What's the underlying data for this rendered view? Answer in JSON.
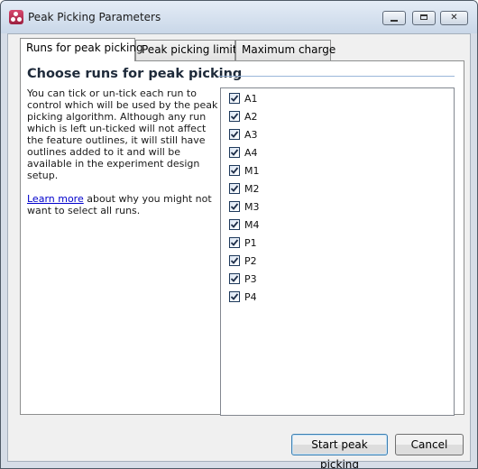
{
  "window": {
    "title": "Peak Picking Parameters"
  },
  "tabs": [
    {
      "label": "Runs for peak picking",
      "active": true
    },
    {
      "label": "Peak picking limits",
      "active": false
    },
    {
      "label": "Maximum charge",
      "active": false
    }
  ],
  "panel": {
    "heading": "Choose runs for peak picking",
    "description": "You can tick or un-tick each run to control which will be used by the peak picking algorithm. Although any run which is left un-ticked will not affect the feature outlines, it will still have outlines added to it and will be available in the experiment design setup.",
    "learn_more_link": "Learn more",
    "learn_more_rest": " about why you might not want to select all runs."
  },
  "runs": [
    {
      "label": "A1",
      "checked": true
    },
    {
      "label": "A2",
      "checked": true
    },
    {
      "label": "A3",
      "checked": true
    },
    {
      "label": "A4",
      "checked": true
    },
    {
      "label": "M1",
      "checked": true
    },
    {
      "label": "M2",
      "checked": true
    },
    {
      "label": "M3",
      "checked": true
    },
    {
      "label": "M4",
      "checked": true
    },
    {
      "label": "P1",
      "checked": true
    },
    {
      "label": "P2",
      "checked": true
    },
    {
      "label": "P3",
      "checked": true
    },
    {
      "label": "P4",
      "checked": true
    }
  ],
  "buttons": {
    "start": "Start peak picking",
    "cancel": "Cancel"
  }
}
